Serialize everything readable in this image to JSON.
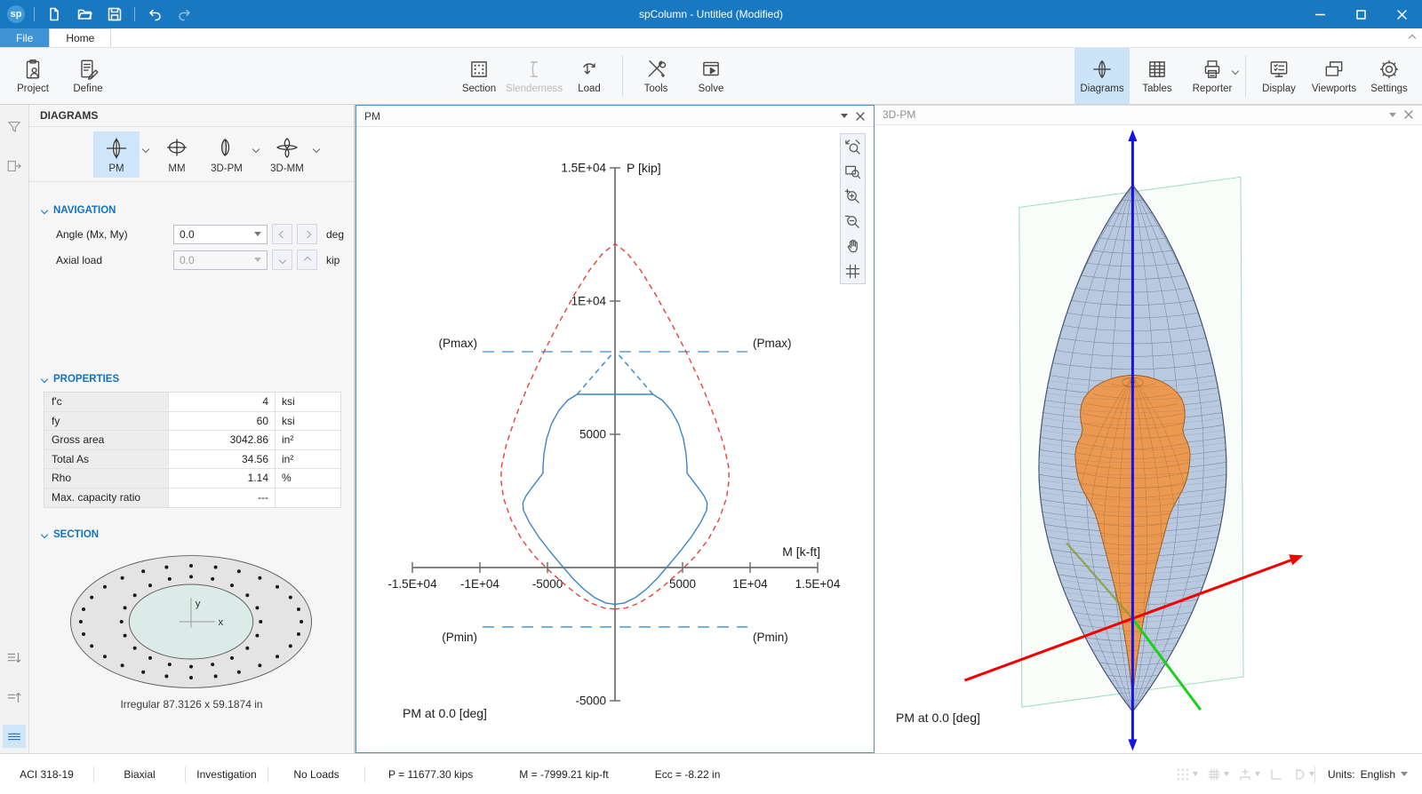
{
  "titlebar": {
    "title": "spColumn - Untitled (Modified)",
    "logo": "sp"
  },
  "tabs": {
    "file": "File",
    "home": "Home"
  },
  "ribbon": {
    "project": "Project",
    "define": "Define",
    "section": "Section",
    "slenderness": "Slenderness",
    "load": "Load",
    "tools": "Tools",
    "solve": "Solve",
    "diagrams": "Diagrams",
    "tables": "Tables",
    "reporter": "Reporter",
    "display": "Display",
    "viewports": "Viewports",
    "settings": "Settings"
  },
  "diagrams_panel": {
    "title": "DIAGRAMS",
    "buttons": {
      "pm": "PM",
      "mm": "MM",
      "pm3d": "3D-PM",
      "mm3d": "3D-MM"
    },
    "navigation": {
      "title": "NAVIGATION",
      "angle_label": "Angle (Mx, My)",
      "angle_value": "0.0",
      "angle_unit": "deg",
      "axial_label": "Axial load",
      "axial_value": "0.0",
      "axial_unit": "kip"
    },
    "properties": {
      "title": "PROPERTIES",
      "rows": [
        {
          "label": "f'c",
          "value": "4",
          "unit": "ksi"
        },
        {
          "label": "fy",
          "value": "60",
          "unit": "ksi"
        },
        {
          "label": "Gross area",
          "value": "3042.86",
          "unit": "in²"
        },
        {
          "label": "Total As",
          "value": "34.56",
          "unit": "in²"
        },
        {
          "label": "Rho",
          "value": "1.14",
          "unit": "%"
        },
        {
          "label": "Max. capacity ratio",
          "value": "---",
          "unit": ""
        }
      ]
    },
    "section": {
      "title": "SECTION",
      "caption": "Irregular 87.3126 x 59.1874 in",
      "axis_x": "x",
      "axis_y": "y"
    }
  },
  "pm_panel": {
    "title": "PM",
    "footer": "PM at 0.0 [deg]"
  },
  "pm3d_panel": {
    "title": "3D-PM",
    "caption": "PM at 0.0 [deg]",
    "colors": {
      "outer": "#a9bcd8",
      "outer_line": "#46536e",
      "inner": "#eb9950",
      "inner_line": "#97581d",
      "axis_mx": "#f40000",
      "axis_my": "#1ecf1e",
      "axis_p": "#1414e6",
      "plane": "#9fdcc0"
    }
  },
  "chart_data": {
    "type": "line",
    "title": "PM interaction diagram at 0.0 deg",
    "xlabel": "M [k-ft]",
    "ylabel": "P [kip]",
    "xlim": [
      -15000,
      15000
    ],
    "ylim": [
      -5000,
      15000
    ],
    "grid": false,
    "legend": "none",
    "xticks": [
      {
        "v": -15000,
        "label": "-1.5E+04"
      },
      {
        "v": -10000,
        "label": "-1E+04"
      },
      {
        "v": -5000,
        "label": "-5000"
      },
      {
        "v": 5000,
        "label": "5000"
      },
      {
        "v": 10000,
        "label": "1E+04"
      },
      {
        "v": 15000,
        "label": "1.5E+04"
      }
    ],
    "yticks": [
      {
        "v": 15000,
        "label": "1.5E+04"
      },
      {
        "v": 10000,
        "label": "1E+04"
      },
      {
        "v": 5000,
        "label": "5000"
      },
      {
        "v": -5000,
        "label": "-5000"
      }
    ],
    "ref_lines": [
      {
        "label": "(Pmax)",
        "p": 8100,
        "m_extent": 9800,
        "color": "#5b9fd8",
        "label_side": "above"
      },
      {
        "label": "(Pmin)",
        "p": -2230,
        "m_extent": 9800,
        "color": "#5b9fd8",
        "label_side": "below"
      }
    ],
    "series": [
      {
        "name": "nominal-capacity",
        "color": "#e8403c",
        "style": "dashed",
        "points": [
          [
            0,
            -1560
          ],
          [
            -800,
            -1520
          ],
          [
            -1700,
            -1350
          ],
          [
            -2700,
            -1050
          ],
          [
            -3700,
            -650
          ],
          [
            -4800,
            -150
          ],
          [
            -5900,
            400
          ],
          [
            -6900,
            1050
          ],
          [
            -7700,
            1800
          ],
          [
            -8250,
            2600
          ],
          [
            -8450,
            3300
          ],
          [
            -8400,
            3800
          ],
          [
            -8050,
            4600
          ],
          [
            -7400,
            5600
          ],
          [
            -6500,
            6750
          ],
          [
            -5400,
            7950
          ],
          [
            -4200,
            9150
          ],
          [
            -3000,
            10250
          ],
          [
            -1900,
            11150
          ],
          [
            -900,
            11800
          ],
          [
            0,
            12150
          ],
          [
            900,
            11800
          ],
          [
            1900,
            11150
          ],
          [
            3000,
            10250
          ],
          [
            4200,
            9150
          ],
          [
            5400,
            7950
          ],
          [
            6500,
            6750
          ],
          [
            7400,
            5600
          ],
          [
            8050,
            4600
          ],
          [
            8400,
            3800
          ],
          [
            8450,
            3300
          ],
          [
            8250,
            2600
          ],
          [
            7700,
            1800
          ],
          [
            6900,
            1050
          ],
          [
            5900,
            400
          ],
          [
            4800,
            -150
          ],
          [
            3700,
            -650
          ],
          [
            2700,
            -1050
          ],
          [
            1700,
            -1350
          ],
          [
            800,
            -1520
          ],
          [
            0,
            -1560
          ]
        ]
      },
      {
        "name": "design-capacity",
        "color": "#3c85c4",
        "style": "solid",
        "points": [
          [
            0,
            -1380
          ],
          [
            -700,
            -1330
          ],
          [
            -1500,
            -1130
          ],
          [
            -2300,
            -820
          ],
          [
            -3100,
            -420
          ],
          [
            -3900,
            50
          ],
          [
            -4800,
            600
          ],
          [
            -5650,
            1150
          ],
          [
            -6350,
            1700
          ],
          [
            -6780,
            2150
          ],
          [
            -6820,
            2430
          ],
          [
            -6600,
            2680
          ],
          [
            -6150,
            3000
          ],
          [
            -5650,
            3330
          ],
          [
            -5330,
            3550
          ],
          [
            -5330,
            3800
          ],
          [
            -5250,
            4300
          ],
          [
            -5050,
            4850
          ],
          [
            -4700,
            5400
          ],
          [
            -4150,
            5900
          ],
          [
            -3500,
            6280
          ],
          [
            -2800,
            6500
          ],
          [
            2800,
            6500
          ],
          [
            3500,
            6280
          ],
          [
            4150,
            5900
          ],
          [
            4700,
            5400
          ],
          [
            5050,
            4850
          ],
          [
            5250,
            4300
          ],
          [
            5330,
            3800
          ],
          [
            5330,
            3550
          ],
          [
            5650,
            3330
          ],
          [
            6150,
            3000
          ],
          [
            6600,
            2680
          ],
          [
            6820,
            2430
          ],
          [
            6780,
            2150
          ],
          [
            6350,
            1700
          ],
          [
            5650,
            1150
          ],
          [
            4800,
            600
          ],
          [
            3900,
            50
          ],
          [
            3100,
            -420
          ],
          [
            2300,
            -820
          ],
          [
            1500,
            -1130
          ],
          [
            700,
            -1330
          ],
          [
            0,
            -1380
          ]
        ]
      },
      {
        "name": "design-capacity-cap",
        "color": "#3c85c4",
        "style": "dashed",
        "segments": [
          [
            [
              -2800,
              6500
            ],
            [
              -220,
              8020
            ]
          ],
          [
            [
              2800,
              6500
            ],
            [
              220,
              8020
            ]
          ]
        ]
      }
    ]
  },
  "statusbar": {
    "code": "ACI 318-19",
    "bending": "Biaxial",
    "mode": "Investigation",
    "loads": "No Loads",
    "p": "P = 11677.30 kips",
    "m": "M = -7999.21 kip-ft",
    "ecc": "Ecc = -8.22 in",
    "units_label": "Units:",
    "units_value": "English"
  }
}
